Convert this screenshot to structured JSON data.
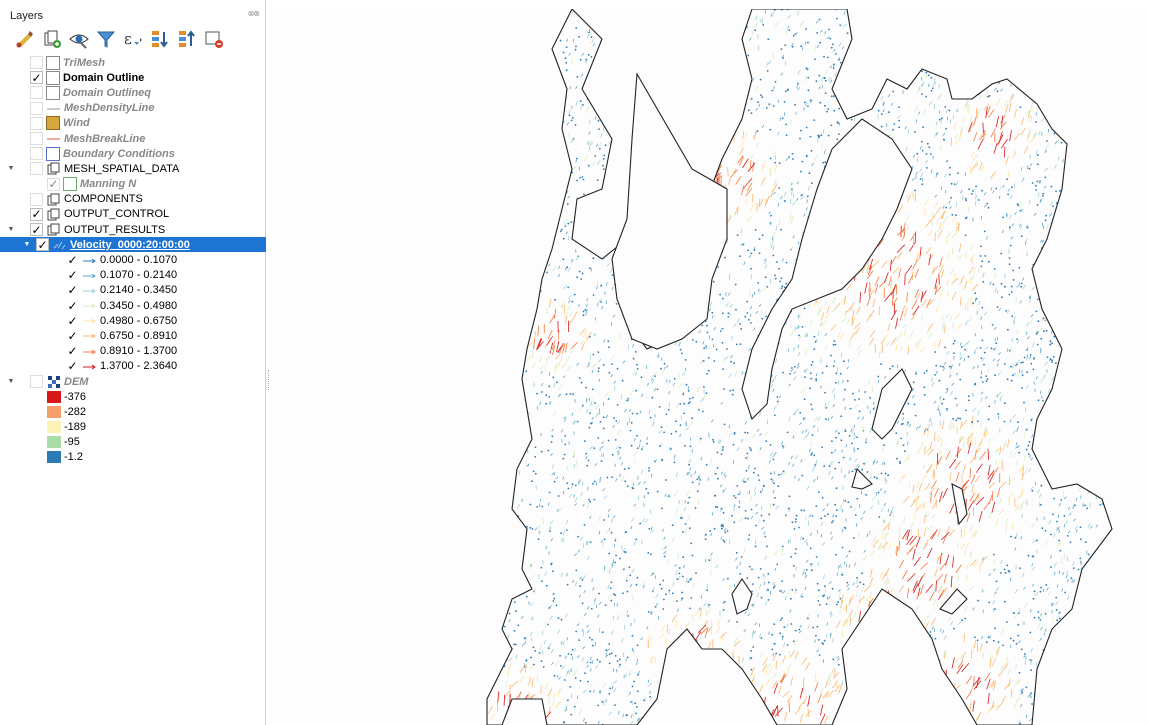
{
  "panel": {
    "title": "Layers"
  },
  "toolbar": [
    "style-icon",
    "add-group-icon",
    "visibility-icon",
    "filter-icon",
    "expression-filter-icon",
    "expand-all-icon",
    "collapse-all-icon",
    "remove-layer-icon"
  ],
  "layers": {
    "trimesh": "TriMesh",
    "domain_outline": "Domain Outline",
    "domain_outlineq": "Domain Outlineq",
    "mesh_density_line": "MeshDensityLine",
    "wind": "Wind",
    "mesh_break_line": "MeshBreakLine",
    "boundary_conditions": "Boundary Conditions",
    "mesh_spatial_data": "MESH_SPATIAL_DATA",
    "manning_n": "Manning N",
    "components": "COMPONENTS",
    "output_control": "OUTPUT_CONTROL",
    "output_results": "OUTPUT_RESULTS",
    "velocity": "Velocity_0000:20:00:00",
    "dem": "DEM"
  },
  "velocity_classes": [
    {
      "label": "0.0000 - 0.1070",
      "color": "#2c7bb6"
    },
    {
      "label": "0.1070 - 0.2140",
      "color": "#5ea7c9"
    },
    {
      "label": "0.2140 - 0.3450",
      "color": "#9fd0d6"
    },
    {
      "label": "0.3450 - 0.4980",
      "color": "#d6ecc5"
    },
    {
      "label": "0.4980 - 0.6750",
      "color": "#fee4a0"
    },
    {
      "label": "0.6750 - 0.8910",
      "color": "#fdb76d"
    },
    {
      "label": "0.8910 - 1.3700",
      "color": "#f4773d"
    },
    {
      "label": "1.3700 - 2.3640",
      "color": "#d7191c"
    }
  ],
  "dem_classes": [
    {
      "label": "-376",
      "color": "#d7191c"
    },
    {
      "label": "-282",
      "color": "#f5a06a"
    },
    {
      "label": "-189",
      "color": "#fdf3b9"
    },
    {
      "label": "-95",
      "color": "#aadca8"
    },
    {
      "label": "-1.2",
      "color": "#2c7bb6"
    }
  ],
  "map": {
    "accent": "#1e74d2"
  }
}
